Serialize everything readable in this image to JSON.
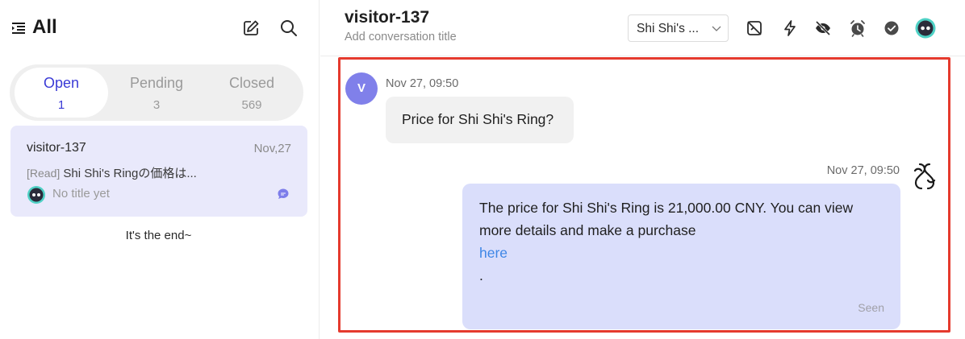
{
  "sidebar": {
    "title": "All",
    "tabs": [
      {
        "label": "Open",
        "count": "1"
      },
      {
        "label": "Pending",
        "count": "3"
      },
      {
        "label": "Closed",
        "count": "569"
      }
    ],
    "conversation": {
      "name": "visitor-137",
      "date": "Nov,27",
      "preview_tag": "[Read]",
      "preview_text": "Shi Shi's Ringの価格は...",
      "title": "No title yet"
    },
    "end_note": "It's the end~"
  },
  "header": {
    "name": "visitor-137",
    "subtitle": "Add conversation title",
    "agent_select": "Shi Shi's ..."
  },
  "messages": {
    "incoming": {
      "avatar_letter": "V",
      "time": "Nov 27, 09:50",
      "text": "Price for Shi Shi's Ring?"
    },
    "outgoing": {
      "time": "Nov 27, 09:50",
      "line1": "The price for Shi Shi's Ring is 21,000.00 CNY. You can view",
      "line2": "more details and make a purchase",
      "link": "here",
      "punct": ".",
      "status": "Seen"
    }
  },
  "colors": {
    "accent": "#3a3ad6",
    "active_card": "#e9e9fb",
    "outgoing_bubble": "#dadefb",
    "visitor_avatar": "#8080ea",
    "highlight_border": "#e53a2e",
    "link": "#3e86e6"
  },
  "icons": {
    "menu": "list-indent-icon",
    "compose": "edit-icon",
    "search": "search-icon",
    "unassign": "unassign-icon",
    "bolt": "lightning-icon",
    "hide": "eye-off-icon",
    "alarm": "alarm-clock-icon",
    "done": "check-circle-icon",
    "bot": "bot-avatar-icon",
    "brand": "brand-logo-icon"
  }
}
